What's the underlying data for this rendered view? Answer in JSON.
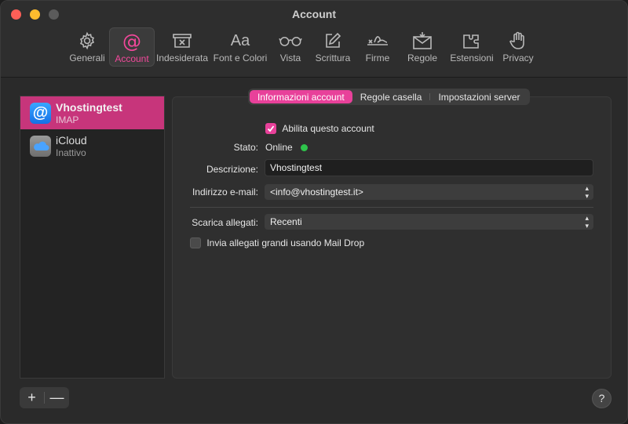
{
  "window": {
    "title": "Account"
  },
  "toolbar": {
    "items": [
      {
        "label": "Generali",
        "icon": "gear-icon"
      },
      {
        "label": "Account",
        "icon": "at-icon"
      },
      {
        "label": "Indesiderata",
        "icon": "junk-tray-icon"
      },
      {
        "label": "Font e Colori",
        "icon": "font-icon"
      },
      {
        "label": "Vista",
        "icon": "glasses-icon"
      },
      {
        "label": "Scrittura",
        "icon": "compose-icon"
      },
      {
        "label": "Firme",
        "icon": "signature-icon"
      },
      {
        "label": "Regole",
        "icon": "rules-envelope-icon"
      },
      {
        "label": "Estensioni",
        "icon": "puzzle-icon"
      },
      {
        "label": "Privacy",
        "icon": "hand-icon"
      }
    ],
    "active": "Account"
  },
  "accounts": [
    {
      "name": "Vhostingtest",
      "type": "IMAP",
      "selected": true
    },
    {
      "name": "iCloud",
      "type": "Inattivo",
      "selected": false
    }
  ],
  "tabs": [
    {
      "label": "Informazioni account",
      "selected": true
    },
    {
      "label": "Regole casella",
      "selected": false
    },
    {
      "label": "Impostazioni server",
      "selected": false
    }
  ],
  "form": {
    "enable_label": "Abilita questo account",
    "enable_checked": true,
    "status_label": "Stato:",
    "status_value": "Online",
    "status_color": "#2ec44b",
    "description_label": "Descrizione:",
    "description_value": "Vhostingtest",
    "email_label": "Indirizzo e-mail:",
    "email_value": "<info@vhostingtest.it>",
    "download_label": "Scarica allegati:",
    "download_value": "Recenti",
    "maildrop_label": "Invia allegati grandi usando Mail Drop",
    "maildrop_checked": false
  },
  "footer": {
    "add": "+",
    "remove": "—",
    "help": "?"
  },
  "colors": {
    "accent": "#e8419a",
    "selection": "#c7357b"
  }
}
